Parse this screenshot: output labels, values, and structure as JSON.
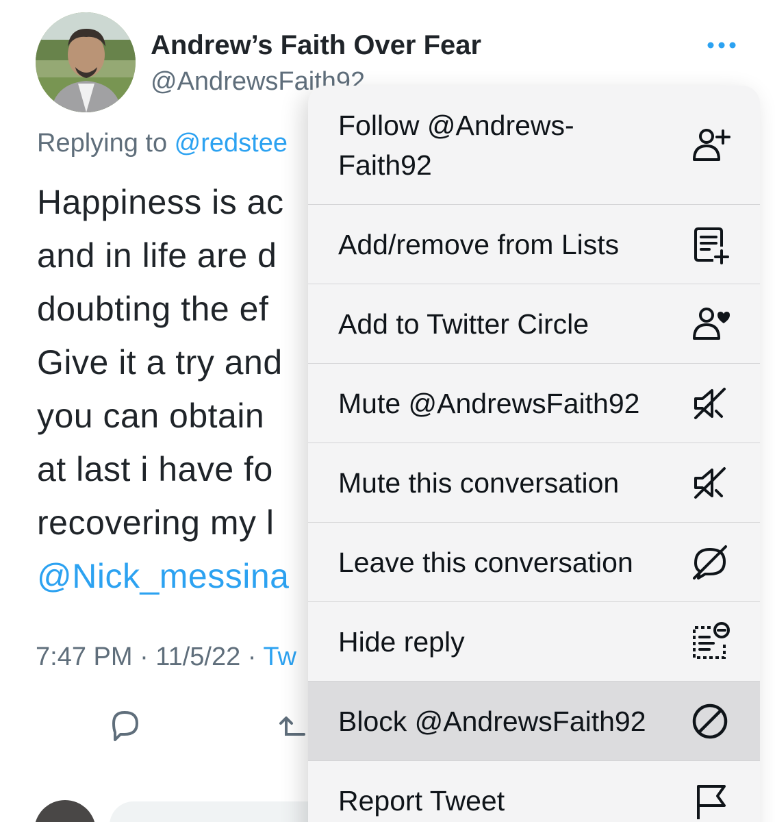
{
  "tweet": {
    "display_name": "Andrew’s Faith Over Fear",
    "handle": "@AndrewsFaith92",
    "replying_prefix": "Replying to ",
    "replying_mention": "@redstee",
    "text_lines": [
      "Happiness is ac",
      "and in life are d",
      "doubting the ef",
      "Give it a try and",
      "you can obtain",
      "at last i have fo",
      "recovering my l"
    ],
    "text_mention": "@Nick_messina",
    "timestamp": "7:47 PM · 11/5/22 · ",
    "source": "Tw"
  },
  "menu": {
    "items": [
      {
        "label": "Follow @Andrews-Faith92",
        "icon": "follow-user-icon"
      },
      {
        "label": "Add/remove from Lists",
        "icon": "list-add-icon"
      },
      {
        "label": "Add to Twitter Circle",
        "icon": "twitter-circle-icon"
      },
      {
        "label": "Mute @AndrewsFaith92",
        "icon": "mute-icon"
      },
      {
        "label": "Mute this conversation",
        "icon": "mute-icon"
      },
      {
        "label": "Leave this conversation",
        "icon": "leave-conversation-icon"
      },
      {
        "label": "Hide reply",
        "icon": "hide-reply-icon"
      },
      {
        "label": "Block @AndrewsFaith92",
        "icon": "block-icon"
      },
      {
        "label": "Report Tweet",
        "icon": "flag-icon"
      }
    ],
    "highlighted_index": 7
  },
  "colors": {
    "link_blue": "#1d9bf0",
    "secondary_text": "#536471",
    "menu_background": "#f4f4f5",
    "menu_highlight": "#dcdcde"
  }
}
